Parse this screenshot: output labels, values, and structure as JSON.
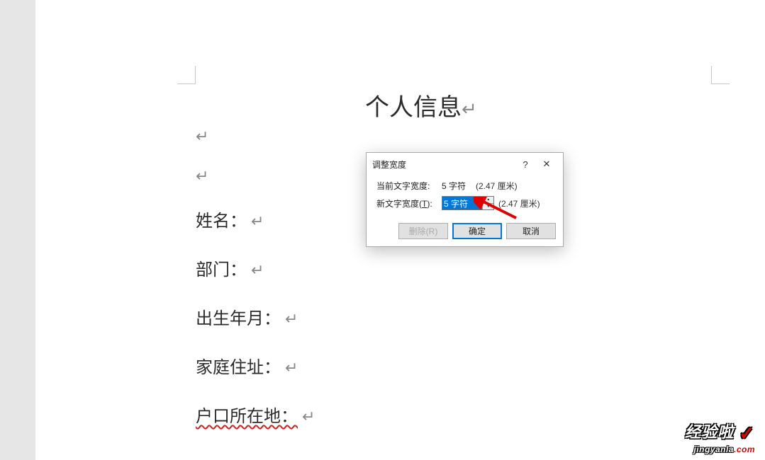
{
  "document": {
    "title": "个人信息",
    "emptyLine": "↵",
    "lines": [
      {
        "label": "姓名：",
        "pilcrow": "↵"
      },
      {
        "label": "部门：",
        "pilcrow": "↵"
      },
      {
        "label": "出生年月：",
        "pilcrow": "↵"
      },
      {
        "label": "家庭住址：",
        "pilcrow": "↵"
      },
      {
        "label": "户口所在地：",
        "pilcrow": "↵"
      }
    ],
    "titlePilcrow": "↵"
  },
  "dialog": {
    "title": "调整宽度",
    "help": "?",
    "close": "✕",
    "currentLabel": "当前文字宽度:",
    "currentValue": "5 字符",
    "currentCm": "(2.47 厘米)",
    "newLabelPrefix": "新文字宽度(",
    "newLabelMnemonic": "T",
    "newLabelSuffix": "):",
    "newValue": "5 字符",
    "newCm": "(2.47 厘米)",
    "deleteBtn": "删除(R)",
    "okBtn": "确定",
    "cancelBtn": "取消"
  },
  "watermark": {
    "line1": "经验啦",
    "check": "✓",
    "line2a": "jingyanla",
    "line2b": ".com"
  }
}
